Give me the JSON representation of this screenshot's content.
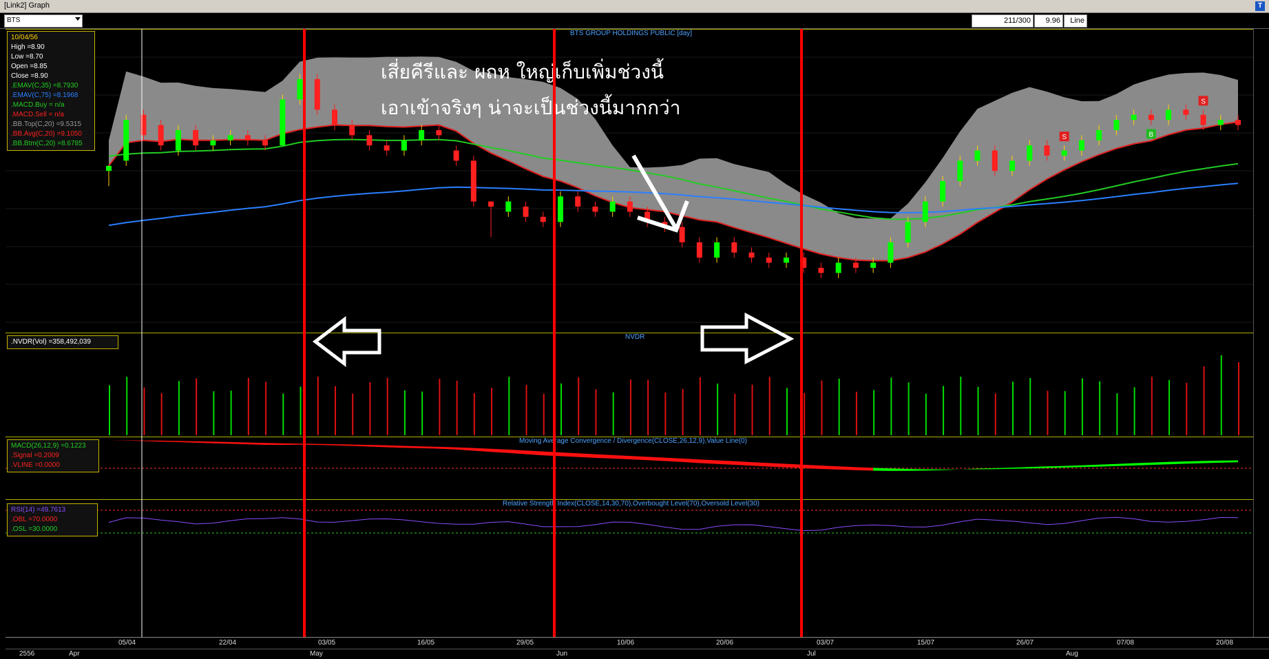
{
  "window": {
    "title": "[Link2] Graph",
    "corner_button": "T"
  },
  "toolbar": {
    "symbol": "BTS",
    "counter": "211/300",
    "price": "9.96",
    "mode": "Line"
  },
  "main": {
    "title": "BTS GROUP HOLDINGS PUBLIC [day]",
    "info": {
      "date": "10/04/56",
      "high": "High  =8.90",
      "low": "Low  =8.70",
      "open": "Open  =8.85",
      "close": "Close  =8.90",
      "emav35": ".EMAV(C,35)   =8.7930",
      "emav75": ".EMAV(C,75)   =8.1968",
      "macd_buy": ".MACD.Buy   = n/a",
      "macd_sell": ".MACD.Sell   = n/a",
      "bb_top": ".BB.Top(C,20)   =9.5315",
      "bb_avg": ".BB.Avg(C,20)   =9.1050",
      "bb_btm": ".BB.Btm(C,20)   =8.6785"
    },
    "annotation_line1": "เสี่ยคีรีและ   ผถห   ใหญ่เก็บเพิ่มช่วงนี้",
    "annotation_line2": "เอาเข้าจริงๆ   น่าจะเป็นช่วงนี้มากกว่า",
    "markers": {
      "sell": "S",
      "buy": "B"
    }
  },
  "nvdr": {
    "title": "NVDR",
    "label": ".NVDR(Vol)   =358,492,039"
  },
  "macd": {
    "title": "Moving Average Convergence / Divergence(CLOSE,26,12,9),Value Line(0)",
    "macd": "MACD(26,12,9)   =0.1223",
    "signal": ".Signal   =0.2009",
    "vline": ".VLINE   =0.0000"
  },
  "rsi": {
    "title": "Relative Strength Index(CLOSE,14,30,70),Overbought Level(70),Oversold Level(30)",
    "rsi": "RSI(14)   =49.7613",
    "obl": ".OBL   =70.0000",
    "osl": ".OSL   =30.0000"
  },
  "xaxis": {
    "year": "2556",
    "months": [
      "Apr",
      "May",
      "Jun",
      "Jul",
      "Aug"
    ],
    "dates": [
      "05/04",
      "22/04",
      "03/05",
      "16/05",
      "29/05",
      "10/06",
      "20/06",
      "03/07",
      "15/07",
      "26/07",
      "07/08",
      "20/08"
    ]
  },
  "colors": {
    "up": "#00ff00",
    "down": "#ff2020",
    "bb_band": "#8a8a8a",
    "ema35": "#22cc22",
    "ema75": "#2a7fff",
    "vline": "#ff0000",
    "accent": "#c8b400"
  },
  "chart_data": {
    "type": "candlestick",
    "candles": [
      {
        "o": 8.85,
        "c": 8.9,
        "h": 8.9,
        "l": 8.7
      },
      {
        "o": 8.95,
        "c": 9.35,
        "h": 9.4,
        "l": 8.9
      },
      {
        "o": 9.4,
        "c": 9.2,
        "h": 9.45,
        "l": 9.15
      },
      {
        "o": 9.3,
        "c": 9.1,
        "h": 9.35,
        "l": 9.05
      },
      {
        "o": 9.05,
        "c": 9.25,
        "h": 9.3,
        "l": 9.0
      },
      {
        "o": 9.25,
        "c": 9.1,
        "h": 9.3,
        "l": 9.05
      },
      {
        "o": 9.1,
        "c": 9.15,
        "h": 9.2,
        "l": 9.05
      },
      {
        "o": 9.15,
        "c": 9.2,
        "h": 9.25,
        "l": 9.1
      },
      {
        "o": 9.2,
        "c": 9.15,
        "h": 9.25,
        "l": 9.1
      },
      {
        "o": 9.15,
        "c": 9.1,
        "h": 9.2,
        "l": 9.05
      },
      {
        "o": 9.1,
        "c": 9.55,
        "h": 9.6,
        "l": 9.1
      },
      {
        "o": 9.55,
        "c": 9.75,
        "h": 9.8,
        "l": 9.5
      },
      {
        "o": 9.75,
        "c": 9.45,
        "h": 9.8,
        "l": 9.4
      },
      {
        "o": 9.45,
        "c": 9.3,
        "h": 9.5,
        "l": 9.25
      },
      {
        "o": 9.3,
        "c": 9.2,
        "h": 9.35,
        "l": 9.15
      },
      {
        "o": 9.2,
        "c": 9.1,
        "h": 9.25,
        "l": 9.05
      },
      {
        "o": 9.1,
        "c": 9.05,
        "h": 9.15,
        "l": 9.0
      },
      {
        "o": 9.05,
        "c": 9.15,
        "h": 9.2,
        "l": 9.0
      },
      {
        "o": 9.15,
        "c": 9.25,
        "h": 9.3,
        "l": 9.1
      },
      {
        "o": 9.25,
        "c": 9.2,
        "h": 9.3,
        "l": 9.15
      },
      {
        "o": 9.05,
        "c": 8.95,
        "h": 9.1,
        "l": 8.9
      },
      {
        "o": 8.95,
        "c": 8.55,
        "h": 9.0,
        "l": 8.5
      },
      {
        "o": 8.55,
        "c": 8.5,
        "h": 8.55,
        "l": 8.2
      },
      {
        "o": 8.45,
        "c": 8.55,
        "h": 8.6,
        "l": 8.4
      },
      {
        "o": 8.5,
        "c": 8.4,
        "h": 8.55,
        "l": 8.35
      },
      {
        "o": 8.4,
        "c": 8.35,
        "h": 8.45,
        "l": 8.3
      },
      {
        "o": 8.35,
        "c": 8.6,
        "h": 8.65,
        "l": 8.3
      },
      {
        "o": 8.6,
        "c": 8.5,
        "h": 8.65,
        "l": 8.45
      },
      {
        "o": 8.5,
        "c": 8.45,
        "h": 8.55,
        "l": 8.4
      },
      {
        "o": 8.45,
        "c": 8.55,
        "h": 8.6,
        "l": 8.4
      },
      {
        "o": 8.55,
        "c": 8.45,
        "h": 8.6,
        "l": 8.4
      },
      {
        "o": 8.45,
        "c": 8.35,
        "h": 8.5,
        "l": 8.3
      },
      {
        "o": 8.35,
        "c": 8.3,
        "h": 8.4,
        "l": 8.25
      },
      {
        "o": 8.3,
        "c": 8.15,
        "h": 8.35,
        "l": 8.1
      },
      {
        "o": 8.15,
        "c": 8.0,
        "h": 8.2,
        "l": 7.95
      },
      {
        "o": 8.0,
        "c": 8.15,
        "h": 8.2,
        "l": 7.95
      },
      {
        "o": 8.15,
        "c": 8.05,
        "h": 8.2,
        "l": 8.0
      },
      {
        "o": 8.05,
        "c": 8.0,
        "h": 8.1,
        "l": 7.95
      },
      {
        "o": 8.0,
        "c": 7.95,
        "h": 8.05,
        "l": 7.9
      },
      {
        "o": 7.95,
        "c": 8.0,
        "h": 8.05,
        "l": 7.9
      },
      {
        "o": 8.0,
        "c": 7.9,
        "h": 8.05,
        "l": 7.85
      },
      {
        "o": 7.9,
        "c": 7.85,
        "h": 7.95,
        "l": 7.8
      },
      {
        "o": 7.85,
        "c": 7.95,
        "h": 8.0,
        "l": 7.8
      },
      {
        "o": 7.95,
        "c": 7.9,
        "h": 8.0,
        "l": 7.85
      },
      {
        "o": 7.9,
        "c": 7.95,
        "h": 8.0,
        "l": 7.85
      },
      {
        "o": 7.95,
        "c": 8.15,
        "h": 8.2,
        "l": 7.9
      },
      {
        "o": 8.15,
        "c": 8.35,
        "h": 8.4,
        "l": 8.1
      },
      {
        "o": 8.35,
        "c": 8.55,
        "h": 8.6,
        "l": 8.3
      },
      {
        "o": 8.55,
        "c": 8.75,
        "h": 8.8,
        "l": 8.5
      },
      {
        "o": 8.75,
        "c": 8.95,
        "h": 9.0,
        "l": 8.7
      },
      {
        "o": 8.95,
        "c": 9.05,
        "h": 9.1,
        "l": 8.9
      },
      {
        "o": 9.05,
        "c": 8.85,
        "h": 9.1,
        "l": 8.8
      },
      {
        "o": 8.85,
        "c": 8.95,
        "h": 9.0,
        "l": 8.8
      },
      {
        "o": 8.95,
        "c": 9.1,
        "h": 9.15,
        "l": 8.9
      },
      {
        "o": 9.1,
        "c": 9.0,
        "h": 9.15,
        "l": 8.95
      },
      {
        "o": 9.0,
        "c": 9.05,
        "h": 9.1,
        "l": 8.95
      },
      {
        "o": 9.05,
        "c": 9.15,
        "h": 9.2,
        "l": 9.0
      },
      {
        "o": 9.15,
        "c": 9.25,
        "h": 9.3,
        "l": 9.1
      },
      {
        "o": 9.25,
        "c": 9.35,
        "h": 9.4,
        "l": 9.2
      },
      {
        "o": 9.35,
        "c": 9.4,
        "h": 9.45,
        "l": 9.3
      },
      {
        "o": 9.4,
        "c": 9.35,
        "h": 9.45,
        "l": 9.3
      },
      {
        "o": 9.35,
        "c": 9.45,
        "h": 9.5,
        "l": 9.3
      },
      {
        "o": 9.45,
        "c": 9.4,
        "h": 9.5,
        "l": 9.35
      },
      {
        "o": 9.4,
        "c": 9.3,
        "h": 9.45,
        "l": 9.25
      },
      {
        "o": 9.3,
        "c": 9.35,
        "h": 9.4,
        "l": 9.25
      },
      {
        "o": 9.35,
        "c": 9.3,
        "h": 9.4,
        "l": 9.25
      }
    ]
  }
}
